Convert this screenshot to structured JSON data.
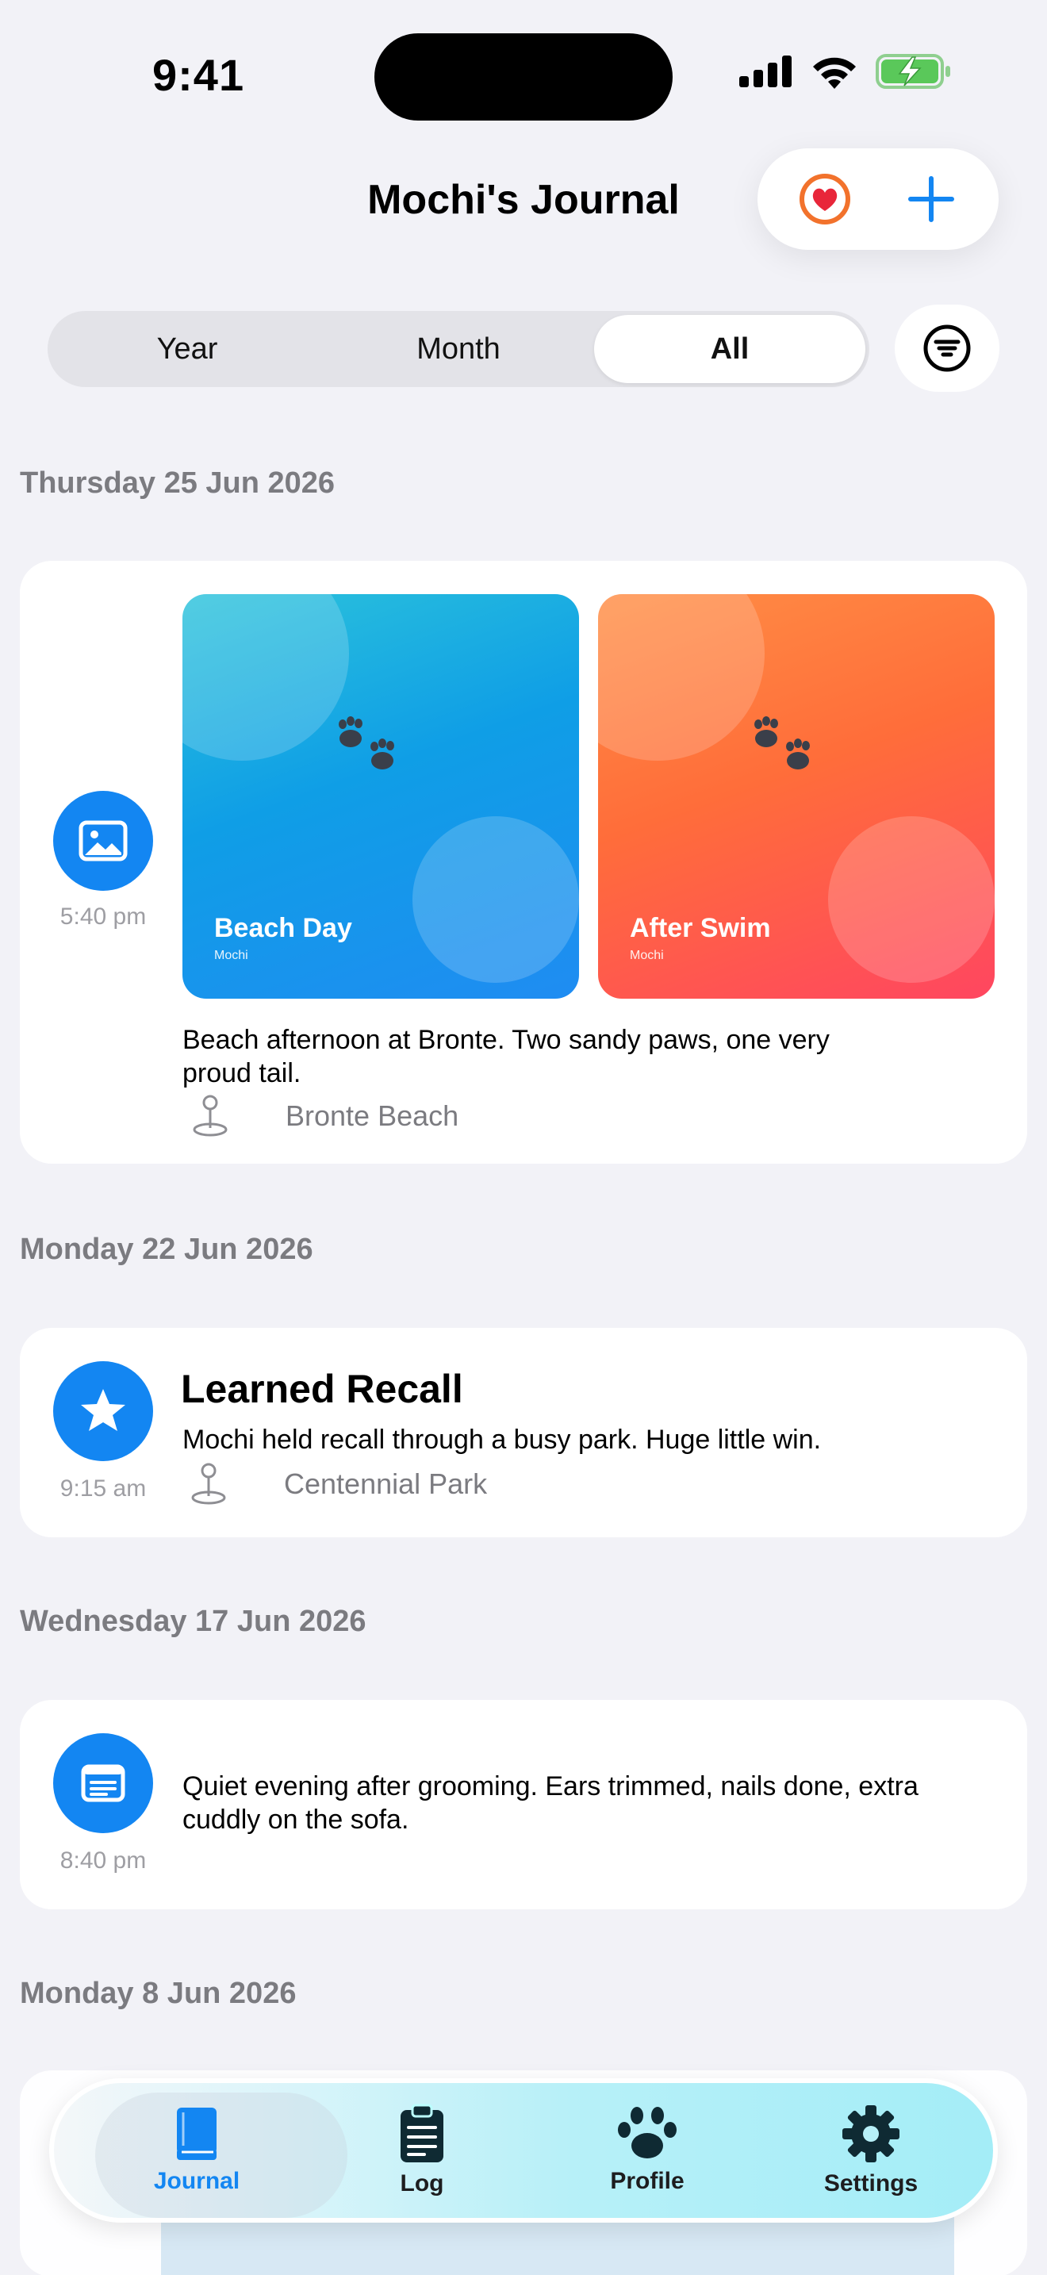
{
  "status_bar": {
    "time": "9:41"
  },
  "nav": {
    "title": "Mochi's Journal",
    "favorite_icon": "heart-circle-icon",
    "add_icon": "plus-icon"
  },
  "segments": {
    "items": [
      "Year",
      "Month",
      "All"
    ],
    "selected": "All"
  },
  "sections": [
    {
      "date": "Thursday 25 Jun 2026",
      "entry": {
        "type_icon": "photo-icon",
        "time": "5:40 pm",
        "photos": [
          {
            "title": "Beach Day",
            "subtitle": "Mochi"
          },
          {
            "title": "After Swim",
            "subtitle": "Mochi"
          }
        ],
        "text": "Beach afternoon at Bronte. Two sandy paws, one very proud tail.",
        "location": "Bronte Beach"
      }
    },
    {
      "date": "Monday 22 Jun 2026",
      "entry": {
        "type_icon": "star-icon",
        "time": "9:15 am",
        "title": "Learned Recall",
        "text": "Mochi held recall through a busy park. Huge little win.",
        "location": "Centennial Park"
      }
    },
    {
      "date": "Wednesday 17 Jun 2026",
      "entry": {
        "type_icon": "note-icon",
        "time": "8:40 pm",
        "text": "Quiet evening after grooming. Ears trimmed, nails done, extra cuddly on the sofa."
      }
    },
    {
      "date": "Monday 8 Jun 2026"
    }
  ],
  "tabbar": {
    "tabs": [
      {
        "label": "Journal",
        "icon": "book-icon",
        "active": true
      },
      {
        "label": "Log",
        "icon": "clipboard-icon",
        "active": false
      },
      {
        "label": "Profile",
        "icon": "paw-icon",
        "active": false
      },
      {
        "label": "Settings",
        "icon": "gear-icon",
        "active": false
      }
    ]
  },
  "colors": {
    "accent": "#1386f2",
    "background": "#f2f2f7",
    "heart": "#f2722c"
  }
}
